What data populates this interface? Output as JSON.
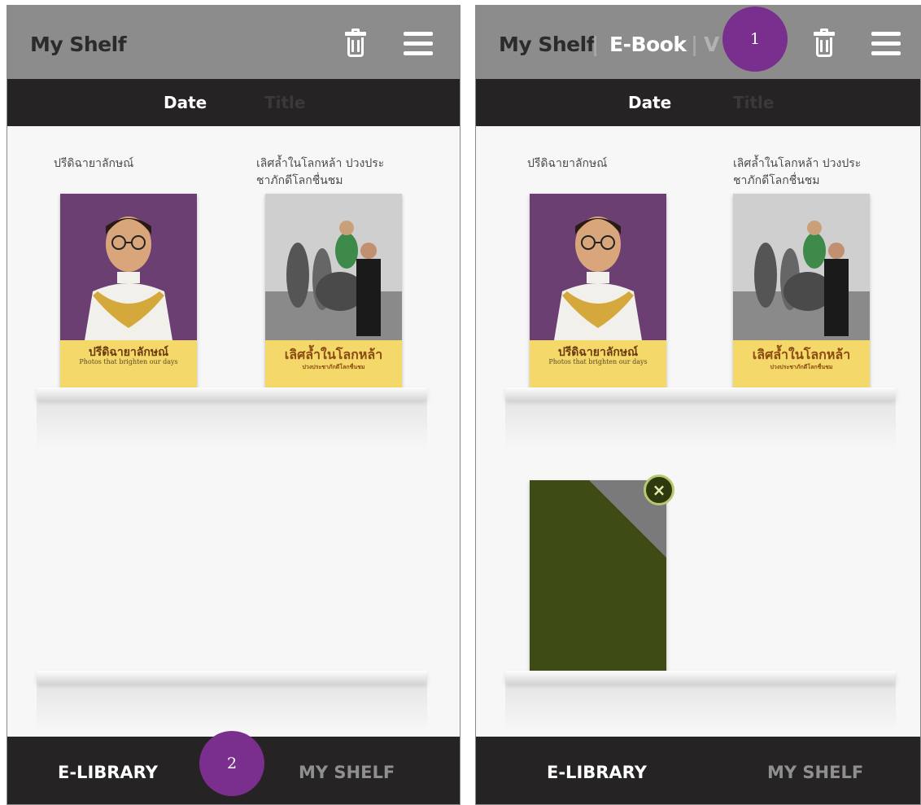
{
  "left_screen": {
    "header": {
      "title": "My Shelf"
    },
    "sort_tabs": [
      {
        "label": "Date"
      },
      {
        "label": "Title"
      }
    ],
    "books": [
      {
        "caption": "ปรีดิฉายาลักษณ์",
        "cover_title": "ปรีดิฉายาลักษณ์",
        "cover_subtitle": "Photos that brighten our days"
      },
      {
        "caption_line1": "เลิศล้ำในโลกหล้า ปวงประ",
        "caption_line2": "ชาภักดีโลกชื่นชม",
        "cover_title": "เลิศล้ำในโลกหล้า",
        "cover_subtitle": "ปวงประชาภักดีโลกชื่นชม"
      }
    ],
    "bottom_nav": [
      {
        "label": "E-LIBRARY"
      },
      {
        "label": "MY SHELF"
      }
    ]
  },
  "right_screen": {
    "header": {
      "title": "My Shelf",
      "separator": "|",
      "tab_ebook": "E-Book",
      "tab_partial": "V"
    },
    "sort_tabs": [
      {
        "label": "Date"
      },
      {
        "label": "Title"
      }
    ],
    "books": [
      {
        "caption": "ปรีดิฉายาลักษณ์",
        "cover_title": "ปรีดิฉายาลักษณ์",
        "cover_subtitle": "Photos that brighten our days"
      },
      {
        "caption_line1": "เลิศล้ำในโลกหล้า ปวงประ",
        "caption_line2": "ชาภักดีโลกชื่นชม",
        "cover_title": "เลิศล้ำในโลกหล้า",
        "cover_subtitle": "ปวงประชาภักดีโลกชื่นชม"
      }
    ],
    "close_glyph": "×",
    "bottom_nav": [
      {
        "label": "E-LIBRARY"
      },
      {
        "label": "MY SHELF"
      }
    ]
  },
  "markers": [
    {
      "label": "1"
    },
    {
      "label": "2"
    }
  ],
  "colors": {
    "header_gray": "#8c8c8c",
    "bar_dark": "#252323",
    "marker_purple": "#7a2f8f",
    "placeholder_green": "#3f4b14"
  }
}
